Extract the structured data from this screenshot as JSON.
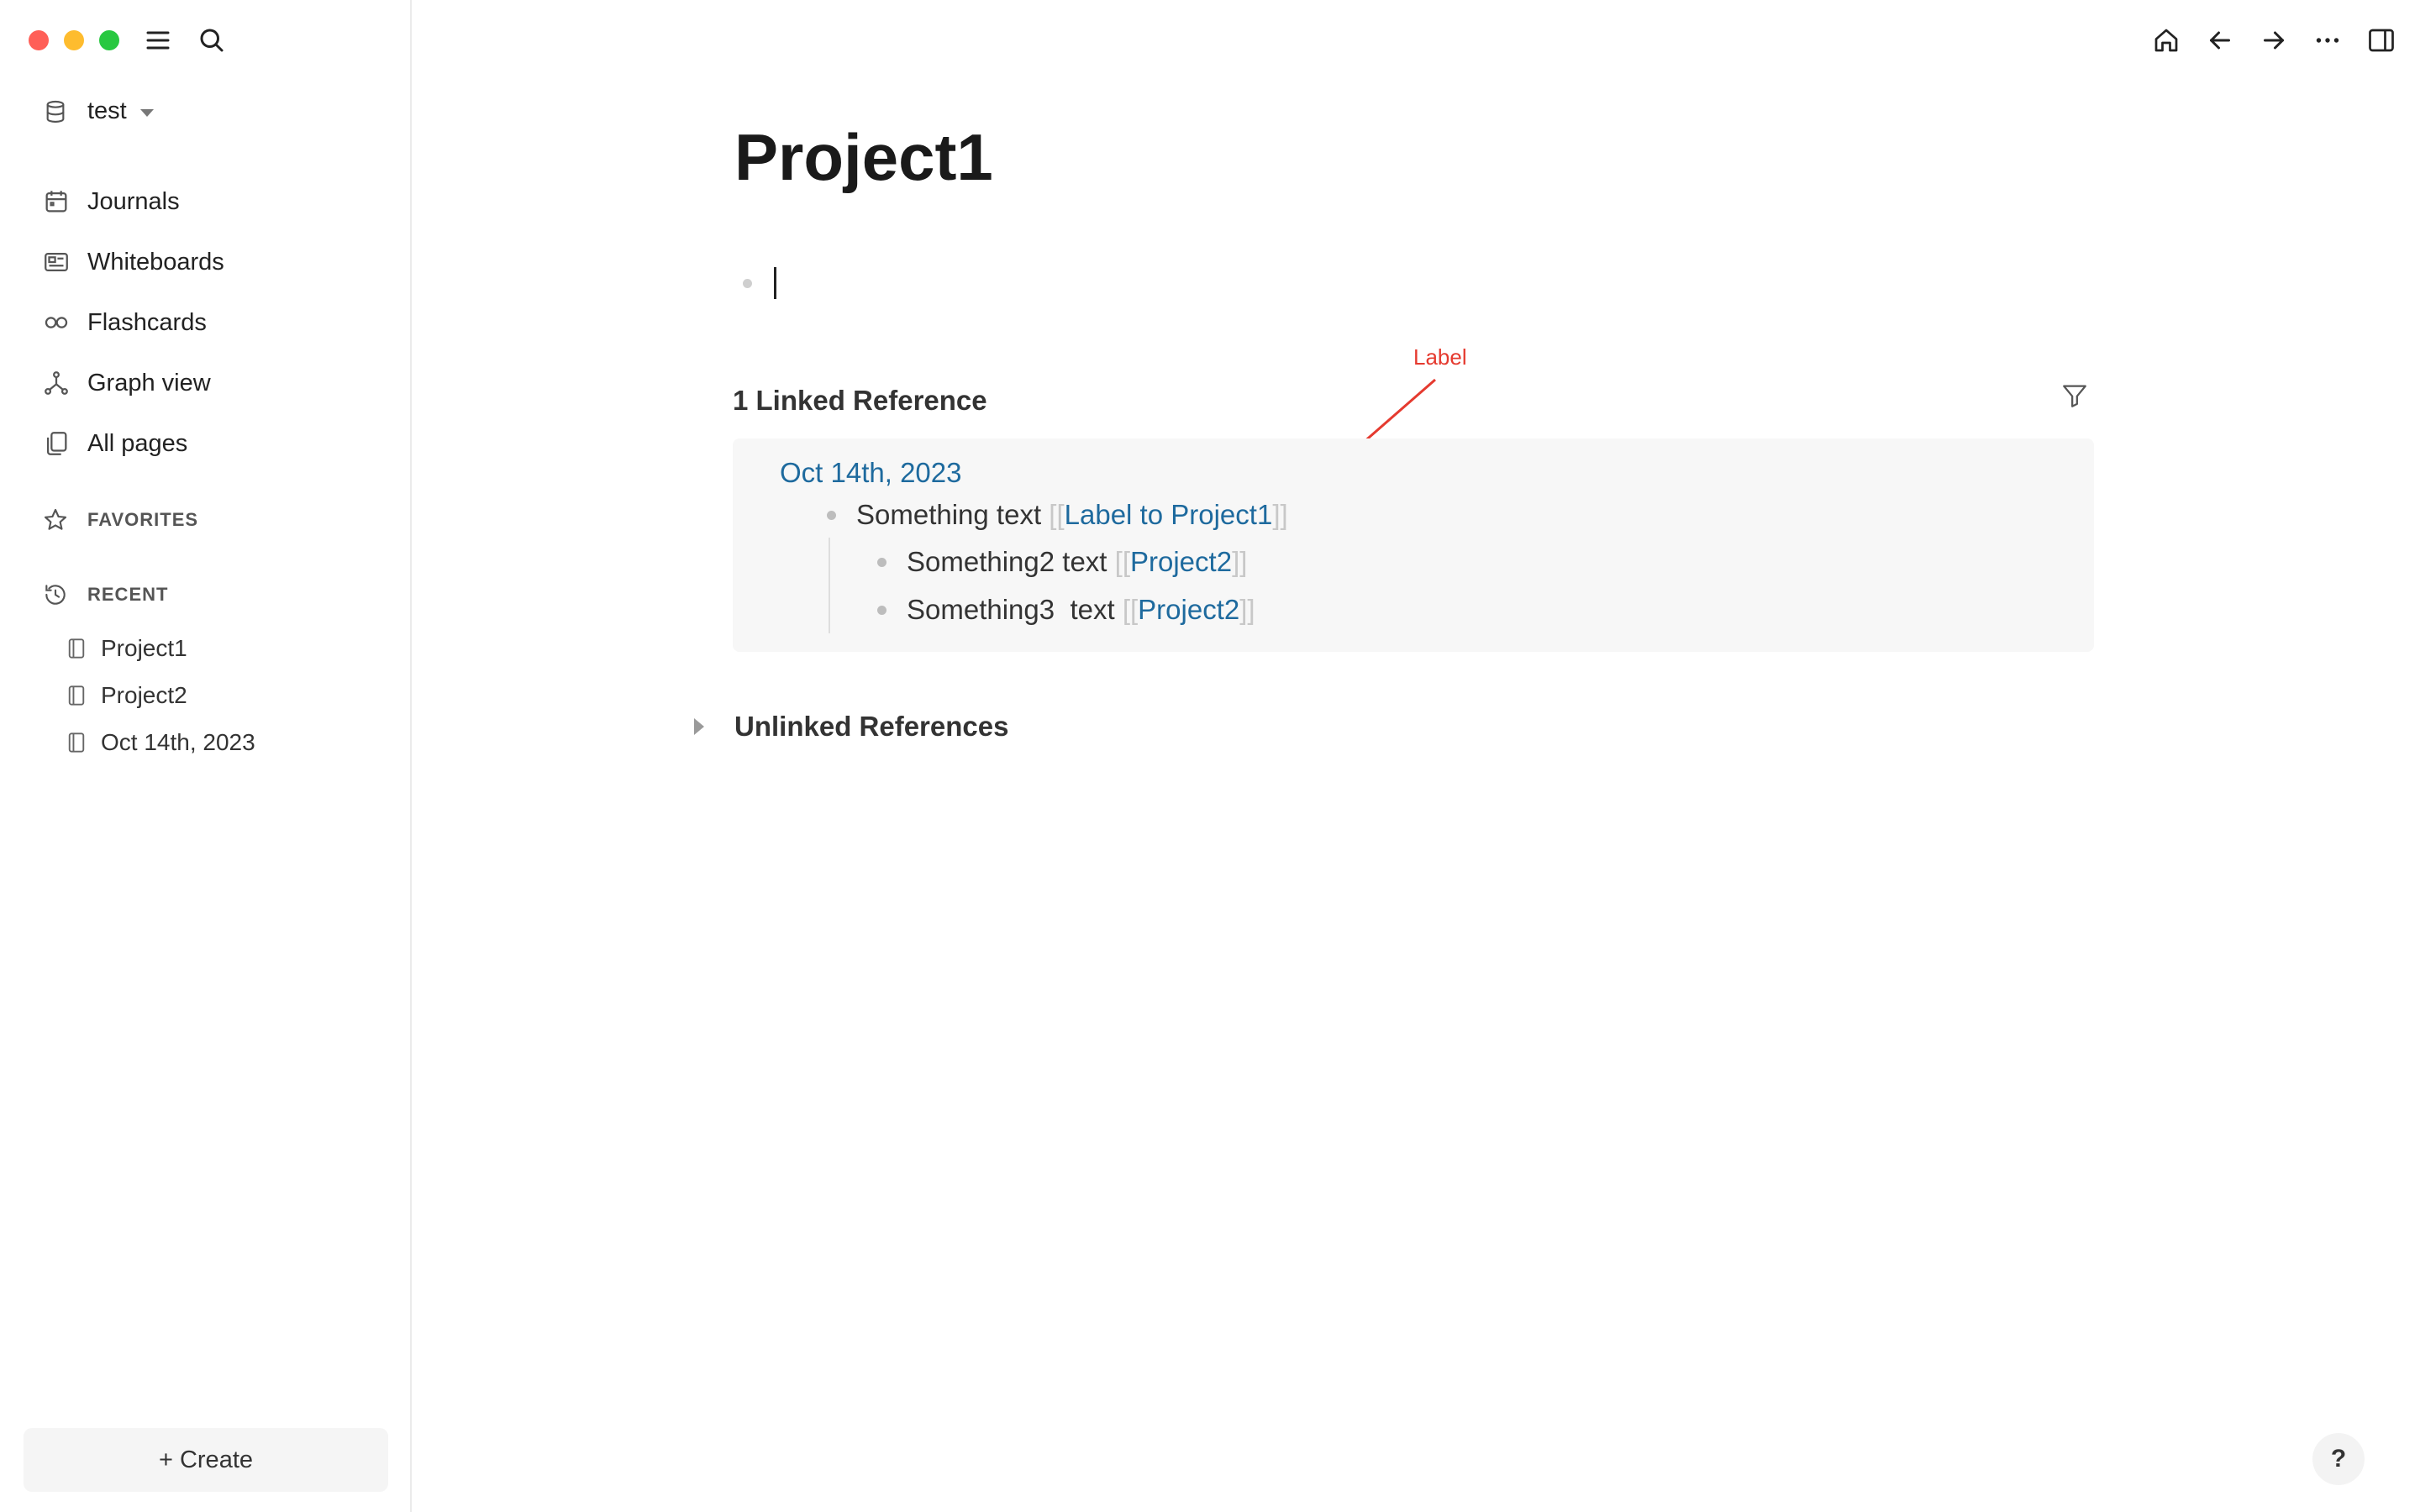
{
  "sidebar": {
    "graph_name": "test",
    "nav": [
      {
        "label": "Journals",
        "icon": "calendar-icon"
      },
      {
        "label": "Whiteboards",
        "icon": "whiteboard-icon"
      },
      {
        "label": "Flashcards",
        "icon": "infinity-icon"
      },
      {
        "label": "Graph view",
        "icon": "graph-icon"
      },
      {
        "label": "All pages",
        "icon": "pages-icon"
      }
    ],
    "favorites_label": "FAVORITES",
    "recent_label": "RECENT",
    "recent": [
      "Project1",
      "Project2",
      "Oct 14th, 2023"
    ],
    "create_label": "+ Create"
  },
  "page": {
    "title": "Project1",
    "linked_heading": "1 Linked Reference",
    "unlinked_heading": "Unlinked References"
  },
  "reference": {
    "date": "Oct 14th, 2023",
    "blocks": [
      {
        "text": "Something text ",
        "open": "[[",
        "link": "Label to Project1",
        "close": "]]"
      },
      {
        "text": "Something2 text ",
        "open": "[[",
        "link": "Project2",
        "close": "]]"
      },
      {
        "text": "Something3  text ",
        "open": "[[",
        "link": "Project2",
        "close": "]]"
      }
    ]
  },
  "annotation": {
    "label": "Label",
    "color": "#e53a2f"
  },
  "help": {
    "label": "?"
  },
  "colors": {
    "link": "#1e6a9e",
    "accent_red": "#ff5f57",
    "accent_yellow": "#febc2e",
    "accent_green": "#28c840"
  }
}
